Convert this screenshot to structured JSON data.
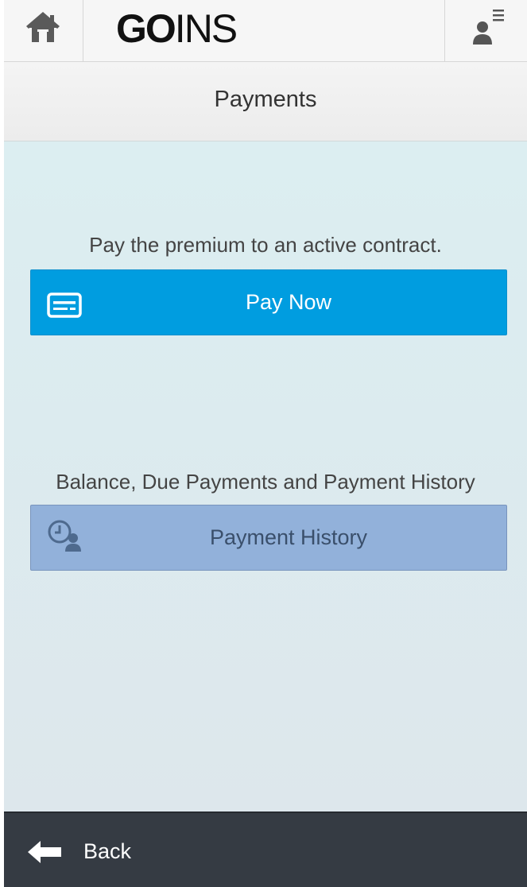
{
  "header": {
    "logo_bold": "GO",
    "logo_light": "INS",
    "home_icon": "home-icon",
    "user_menu_icon": "user-menu-icon"
  },
  "page": {
    "title": "Payments"
  },
  "pay_section": {
    "description": "Pay the premium to an active contract.",
    "button_label": "Pay Now",
    "button_icon": "credit-card-icon",
    "button_color": "#009de0"
  },
  "history_section": {
    "description": "Balance, Due Payments and Payment History",
    "button_label": "Payment History",
    "button_icon": "clock-person-icon",
    "button_color": "#92b1da"
  },
  "footer": {
    "back_label": "Back",
    "back_icon": "arrow-left-icon"
  },
  "colors": {
    "footer_bg": "#353b43",
    "content_bg": "#dceef1"
  }
}
